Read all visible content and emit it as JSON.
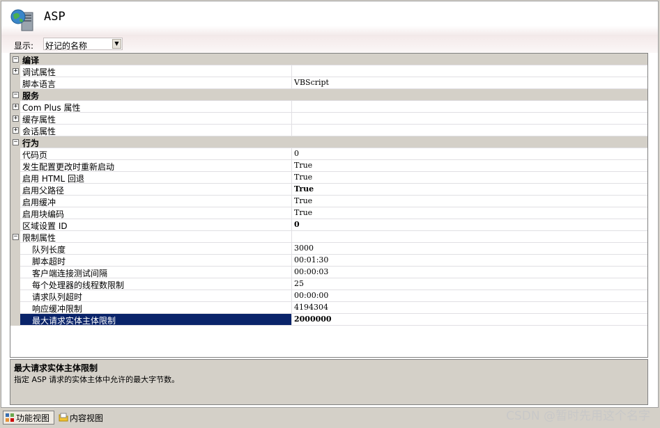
{
  "header": {
    "title": "ASP"
  },
  "filter": {
    "label": "显示:",
    "selected": "好记的名称"
  },
  "grid": {
    "rows": [
      {
        "kind": "cat",
        "toggle": "⊟",
        "name": "编译",
        "value": ""
      },
      {
        "kind": "sub",
        "toggle": "⊞",
        "name": "调试属性",
        "value": ""
      },
      {
        "kind": "sub",
        "toggle": "",
        "name": "脚本语言",
        "value": "VBScript",
        "bold": false
      },
      {
        "kind": "cat",
        "toggle": "⊟",
        "name": "服务",
        "value": ""
      },
      {
        "kind": "sub",
        "toggle": "⊞",
        "name": "Com Plus 属性",
        "value": ""
      },
      {
        "kind": "sub",
        "toggle": "⊞",
        "name": "缓存属性",
        "value": ""
      },
      {
        "kind": "sub",
        "toggle": "⊞",
        "name": "会话属性",
        "value": ""
      },
      {
        "kind": "cat",
        "toggle": "⊟",
        "name": "行为",
        "value": ""
      },
      {
        "kind": "sub",
        "toggle": "",
        "name": "代码页",
        "value": "0",
        "bold": false
      },
      {
        "kind": "sub",
        "toggle": "",
        "name": "发生配置更改时重新启动",
        "value": "True",
        "bold": false
      },
      {
        "kind": "sub",
        "toggle": "",
        "name": "启用 HTML 回退",
        "value": "True",
        "bold": false
      },
      {
        "kind": "sub",
        "toggle": "",
        "name": "启用父路径",
        "value": "True",
        "bold": true
      },
      {
        "kind": "sub",
        "toggle": "",
        "name": "启用缓冲",
        "value": "True",
        "bold": false
      },
      {
        "kind": "sub",
        "toggle": "",
        "name": "启用块编码",
        "value": "True",
        "bold": false
      },
      {
        "kind": "sub",
        "toggle": "",
        "name": "区域设置 ID",
        "value": "0",
        "bold": true
      },
      {
        "kind": "sub",
        "toggle": "⊟",
        "name": "限制属性",
        "value": ""
      },
      {
        "kind": "sub2",
        "toggle": "",
        "name": "队列长度",
        "value": "3000",
        "bold": false
      },
      {
        "kind": "sub2",
        "toggle": "",
        "name": "脚本超时",
        "value": "00:01:30",
        "bold": false
      },
      {
        "kind": "sub2",
        "toggle": "",
        "name": "客户端连接测试间隔",
        "value": "00:00:03",
        "bold": false
      },
      {
        "kind": "sub2",
        "toggle": "",
        "name": "每个处理器的线程数限制",
        "value": "25",
        "bold": false
      },
      {
        "kind": "sub2",
        "toggle": "",
        "name": "请求队列超时",
        "value": "00:00:00",
        "bold": false
      },
      {
        "kind": "sub2",
        "toggle": "",
        "name": "响应缓冲限制",
        "value": "4194304",
        "bold": false
      },
      {
        "kind": "sub2",
        "toggle": "",
        "name": "最大请求实体主体限制",
        "value": "2000000",
        "bold": true,
        "selected": true
      }
    ]
  },
  "description": {
    "title": "最大请求实体主体限制",
    "text": "指定 ASP 请求的实体主体中允许的最大字节数。"
  },
  "bottom": {
    "tabs": [
      {
        "label": "功能视图",
        "icon": "features-view-icon"
      },
      {
        "label": "内容视图",
        "icon": "content-view-icon"
      }
    ]
  },
  "watermark": "CSDN @暂时先用这个名字",
  "colors": {
    "selection": "#0a246a",
    "chrome": "#d4d0c8"
  }
}
